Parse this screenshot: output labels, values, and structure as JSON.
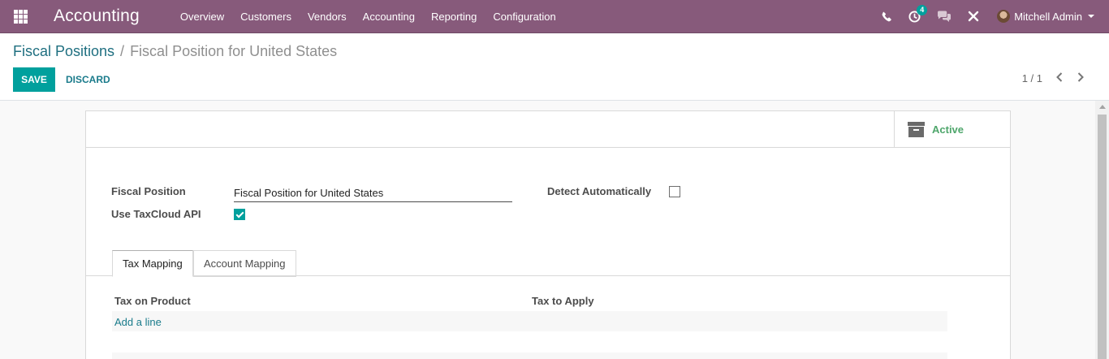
{
  "navbar": {
    "brand": "Accounting",
    "menu": [
      "Overview",
      "Customers",
      "Vendors",
      "Accounting",
      "Reporting",
      "Configuration"
    ],
    "activity_count": "4",
    "user_name": "Mitchell Admin"
  },
  "control_panel": {
    "breadcrumb_parent": "Fiscal Positions",
    "breadcrumb_separator": "/",
    "breadcrumb_current": "Fiscal Position for United States",
    "save_label": "SAVE",
    "discard_label": "DISCARD",
    "pager_value": "1 / 1"
  },
  "form": {
    "active_label": "Active",
    "fiscal_position_label": "Fiscal Position",
    "fiscal_position_value": "Fiscal Position for United States",
    "taxcloud_label": "Use TaxCloud API",
    "taxcloud_checked": true,
    "detect_label": "Detect Automatically",
    "detect_checked": false,
    "tabs": [
      "Tax Mapping",
      "Account Mapping"
    ],
    "active_tab": "Tax Mapping",
    "columns": [
      "Tax on Product",
      "Tax to Apply"
    ],
    "add_line_label": "Add a line"
  },
  "colors": {
    "navbar": "#875a7b",
    "primary": "#00a09d",
    "link": "#1a7b8b",
    "active_green": "#4ea66b"
  }
}
